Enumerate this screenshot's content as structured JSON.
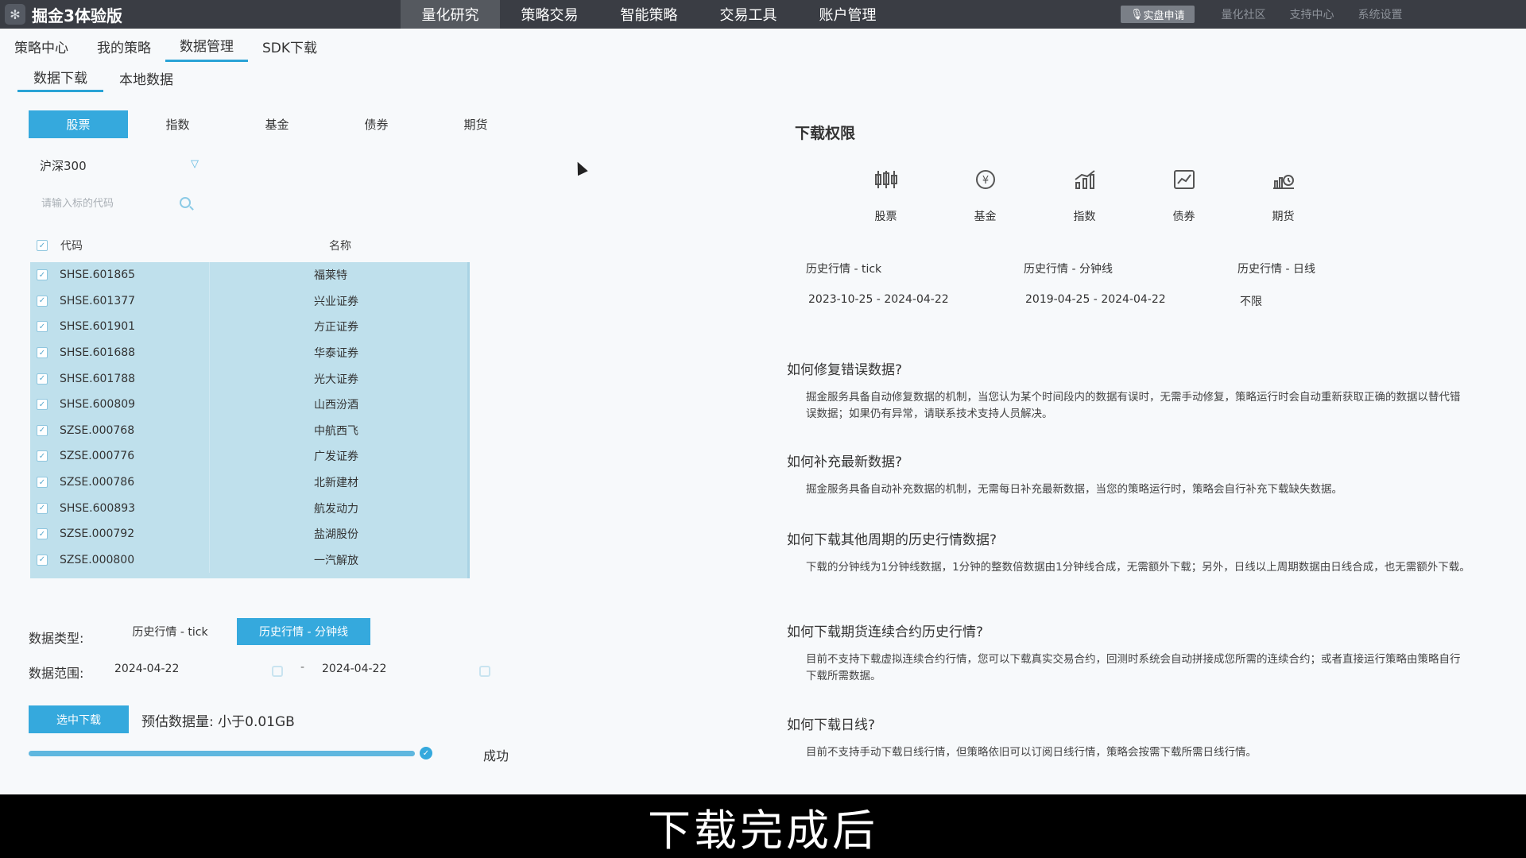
{
  "app": {
    "title": "掘金3体验版"
  },
  "topnav": [
    "量化研究",
    "策略交易",
    "智能策略",
    "交易工具",
    "账户管理"
  ],
  "topright": {
    "apply": "实盘申请",
    "links": [
      "量化社区",
      "支持中心",
      "系统设置"
    ]
  },
  "subnav": [
    "策略中心",
    "我的策略",
    "数据管理",
    "SDK下载"
  ],
  "subnav2": [
    "数据下载",
    "本地数据"
  ],
  "categories": [
    "股票",
    "指数",
    "基金",
    "债券",
    "期货"
  ],
  "index_select": "沪深300",
  "search_placeholder": "请输入标的代码",
  "table": {
    "headers": [
      "代码",
      "名称"
    ],
    "rows": [
      {
        "code": "SHSE.601865",
        "name": "福莱特"
      },
      {
        "code": "SHSE.601377",
        "name": "兴业证券"
      },
      {
        "code": "SHSE.601901",
        "name": "方正证券"
      },
      {
        "code": "SHSE.601688",
        "name": "华泰证券"
      },
      {
        "code": "SHSE.601788",
        "name": "光大证券"
      },
      {
        "code": "SHSE.600809",
        "name": "山西汾酒"
      },
      {
        "code": "SZSE.000768",
        "name": "中航西飞"
      },
      {
        "code": "SZSE.000776",
        "name": "广发证券"
      },
      {
        "code": "SZSE.000786",
        "name": "北新建材"
      },
      {
        "code": "SHSE.600893",
        "name": "航发动力"
      },
      {
        "code": "SZSE.000792",
        "name": "盐湖股份"
      },
      {
        "code": "SZSE.000800",
        "name": "一汽解放"
      }
    ]
  },
  "data_type": {
    "label": "数据类型:",
    "options": [
      "历史行情 - tick",
      "历史行情 - 分钟线"
    ],
    "selected": "历史行情 - 分钟线"
  },
  "data_range": {
    "label": "数据范围:",
    "start": "2024-04-22",
    "end": "2024-04-22",
    "separator": "-"
  },
  "download": {
    "button": "选中下载",
    "estimate": "预估数据量: 小于0.01GB",
    "progress": 1.0,
    "status": "成功"
  },
  "permissions": {
    "title": "下载权限",
    "icons": [
      {
        "label": "股票",
        "icon": "candlestick-icon"
      },
      {
        "label": "基金",
        "icon": "fund-icon"
      },
      {
        "label": "指数",
        "icon": "index-chart-icon"
      },
      {
        "label": "债券",
        "icon": "bond-chart-icon"
      },
      {
        "label": "期货",
        "icon": "futures-icon"
      }
    ],
    "history": [
      {
        "label": "历史行情 - tick",
        "value": "2023-10-25 - 2024-04-22"
      },
      {
        "label": "历史行情 - 分钟线",
        "value": "2019-04-25 - 2024-04-22"
      },
      {
        "label": "历史行情 - 日线",
        "value": "不限"
      }
    ]
  },
  "faq": [
    {
      "q": "如何修复错误数据?",
      "a": "掘金服务具备自动修复数据的机制，当您认为某个时间段内的数据有误时，无需手动修复，策略运行时会自动重新获取正确的数据以替代错误数据；如果仍有异常，请联系技术支持人员解决。"
    },
    {
      "q": "如何补充最新数据?",
      "a": "掘金服务具备自动补充数据的机制，无需每日补充最新数据，当您的策略运行时，策略会自行补充下载缺失数据。"
    },
    {
      "q": "如何下载其他周期的历史行情数据?",
      "a": "下载的分钟线为1分钟线数据，1分钟的整数倍数据由1分钟线合成，无需额外下载；另外，日线以上周期数据由日线合成，也无需额外下载。"
    },
    {
      "q": "如何下载期货连续合约历史行情?",
      "a": "目前不支持下载虚拟连续合约行情，您可以下载真实交易合约，回测时系统会自动拼接成您所需的连续合约；或者直接运行策略由策略自行下载所需数据。"
    },
    {
      "q": "如何下载日线?",
      "a": "目前不支持手动下载日线行情，但策略依旧可以订阅日线行情，策略会按需下载所需日线行情。"
    }
  ],
  "subtitle": "下载完成后",
  "colors": {
    "accent": "#35a9dd",
    "topbar": "#3a3d44",
    "selection": "#bfe0ec"
  }
}
